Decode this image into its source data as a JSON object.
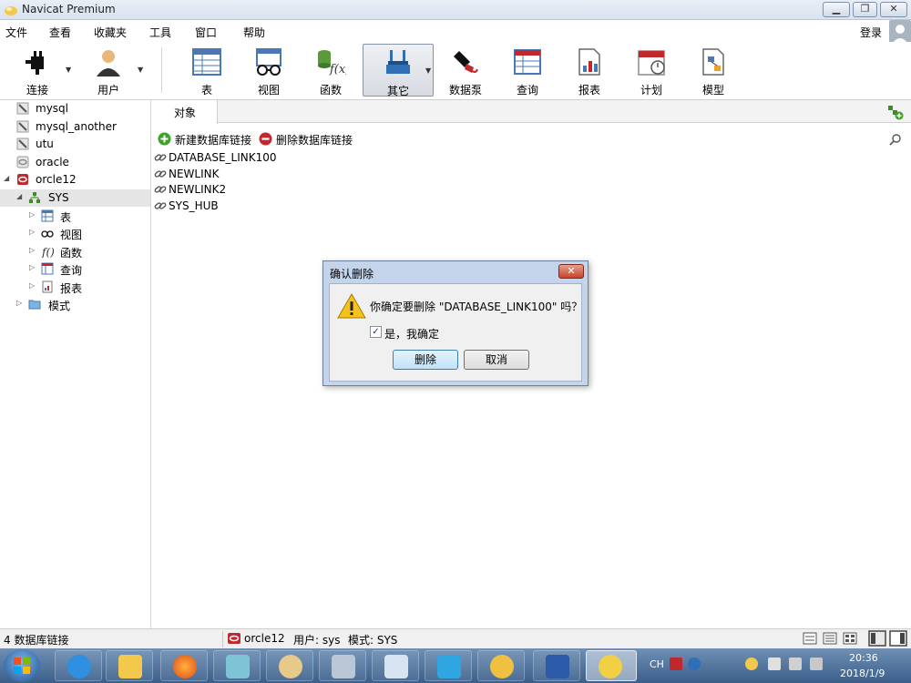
{
  "window": {
    "title": "Navicat Premium",
    "min_label": "▁",
    "max_label": "❐",
    "close_label": "✕"
  },
  "menu": {
    "items": [
      "文件",
      "查看",
      "收藏夹",
      "工具",
      "窗口",
      "帮助"
    ],
    "login": "登录"
  },
  "toolbar": {
    "buttons": [
      {
        "label": "连接",
        "icon": "plug-icon"
      },
      {
        "label": "用户",
        "icon": "user-icon"
      },
      {
        "label": "表",
        "icon": "table-icon"
      },
      {
        "label": "视图",
        "icon": "view-icon"
      },
      {
        "label": "函数",
        "icon": "function-icon"
      },
      {
        "label": "其它",
        "icon": "tools-icon",
        "active": true
      },
      {
        "label": "数据泵",
        "icon": "datapump-icon"
      },
      {
        "label": "查询",
        "icon": "query-icon"
      },
      {
        "label": "报表",
        "icon": "report-icon"
      },
      {
        "label": "计划",
        "icon": "calendar-icon"
      },
      {
        "label": "模型",
        "icon": "model-icon"
      }
    ]
  },
  "sidebar": {
    "connections": [
      {
        "label": "mysql",
        "icon": "mysql-connection-icon"
      },
      {
        "label": "mysql_another",
        "icon": "mysql-connection-icon"
      },
      {
        "label": "utu",
        "icon": "mysql-connection-icon"
      },
      {
        "label": "oracle",
        "icon": "oracle-connection-icon"
      },
      {
        "label": "orcle12",
        "icon": "oracle-connection-icon",
        "expanded": true
      }
    ],
    "schema": {
      "label": "SYS",
      "selected": true
    },
    "schema_children": [
      {
        "label": "表",
        "icon": "table-icon"
      },
      {
        "label": "视图",
        "icon": "view-icon"
      },
      {
        "label": "函数",
        "icon": "function-icon"
      },
      {
        "label": "查询",
        "icon": "query-icon"
      },
      {
        "label": "报表",
        "icon": "report-icon"
      }
    ],
    "models": {
      "label": "模式",
      "icon": "folder-icon"
    }
  },
  "content": {
    "tab_label": "对象",
    "actions": {
      "new_link": "新建数据库链接",
      "delete_link": "删除数据库链接"
    },
    "objects": [
      "DATABASE_LINK100",
      "NEWLINK",
      "NEWLINK2",
      "SYS_HUB"
    ]
  },
  "dialog": {
    "title": "确认删除",
    "message": "你确定要删除 \"DATABASE_LINK100\" 吗？",
    "checkbox_label": "是，我确定",
    "checkbox_checked": true,
    "checkbox_mark": "✓",
    "delete_label": "删除",
    "cancel_label": "取消"
  },
  "status": {
    "count": "4 数据库链接",
    "connection": "orcle12",
    "user": "用户: sys",
    "schema": "模式: SYS"
  },
  "taskbar": {
    "apps": [
      "ie-icon",
      "explorer-icon",
      "firefox-icon",
      "app-icon",
      "paint-icon",
      "calculator-icon",
      "snipping-icon",
      "bird-icon",
      "search-icon",
      "word-icon",
      "navicat-icon"
    ],
    "ime": "CH",
    "time": "20:36",
    "date": "2018/1/9"
  },
  "colors": {
    "accent": "#3c7fb1",
    "oracle_red": "#c0282d",
    "link_blue": "#1c3d87"
  }
}
